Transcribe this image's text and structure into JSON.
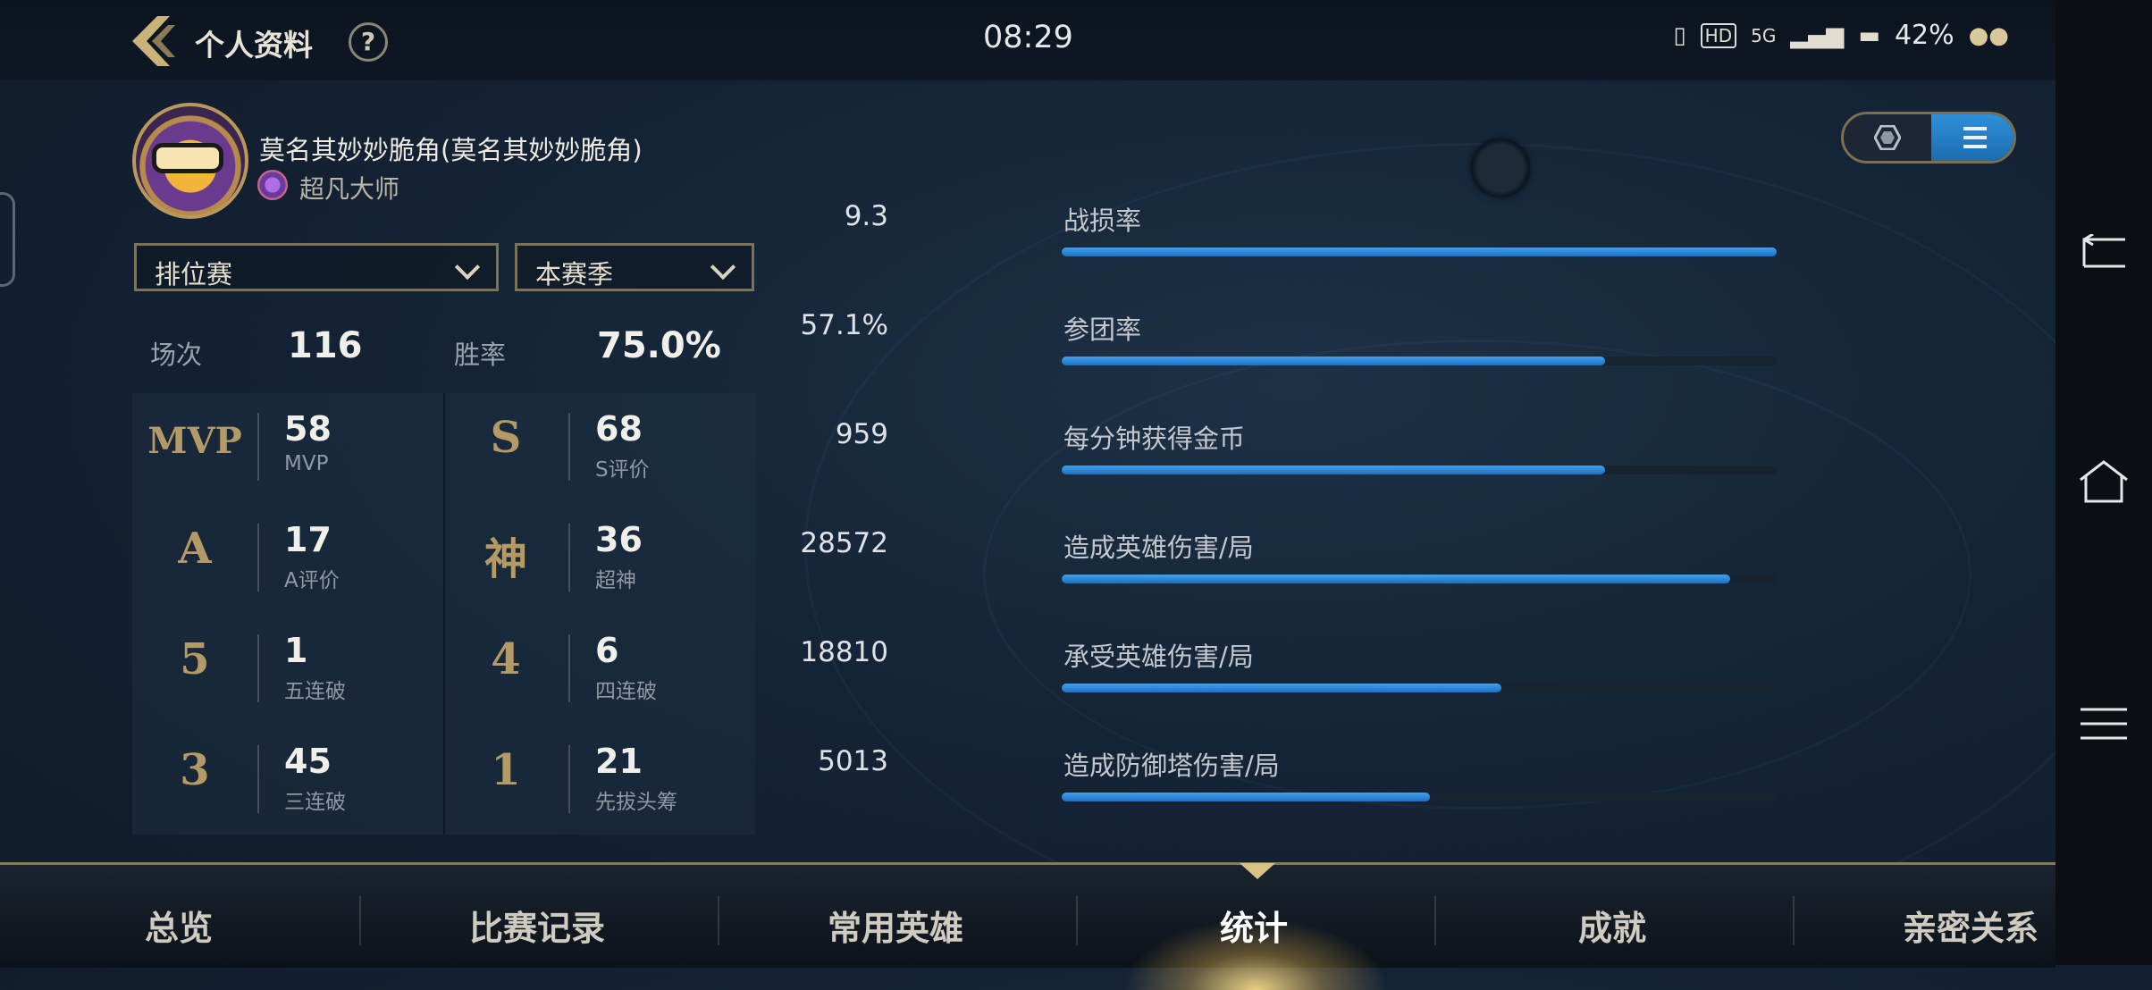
{
  "header": {
    "title": "个人资料",
    "help_label": "?",
    "time": "08:29"
  },
  "status_bar": {
    "battery": "42%",
    "network": "5G",
    "hd": "HD"
  },
  "profile": {
    "name": "莫名其妙妙脆角(莫名其妙妙脆角)",
    "rank": "超凡大师"
  },
  "filters": {
    "mode": "排位赛",
    "season": "本赛季"
  },
  "summary": {
    "games_label": "场次",
    "games": "116",
    "winrate_label": "胜率",
    "winrate": "75.0%"
  },
  "stats": [
    {
      "symbol": "MVP",
      "value": "58",
      "label": "MVP"
    },
    {
      "symbol": "S",
      "value": "68",
      "label": "S评价"
    },
    {
      "symbol": "A",
      "value": "17",
      "label": "A评价"
    },
    {
      "symbol": "神",
      "value": "36",
      "label": "超神"
    },
    {
      "symbol": "5",
      "value": "1",
      "label": "五连破"
    },
    {
      "symbol": "4",
      "value": "6",
      "label": "四连破"
    },
    {
      "symbol": "3",
      "value": "45",
      "label": "三连破"
    },
    {
      "symbol": "1",
      "value": "21",
      "label": "先拔头筹"
    }
  ],
  "metrics": [
    {
      "label": "战损率",
      "value": "9.3",
      "fill": 1.0
    },
    {
      "label": "参团率",
      "value": "57.1%",
      "fill": 0.76
    },
    {
      "label": "每分钟获得金币",
      "value": "959",
      "fill": 0.76
    },
    {
      "label": "造成英雄伤害/局",
      "value": "28572",
      "fill": 0.935
    },
    {
      "label": "承受英雄伤害/局",
      "value": "18810",
      "fill": 0.615
    },
    {
      "label": "造成防御塔伤害/局",
      "value": "5013",
      "fill": 0.515
    }
  ],
  "view_toggle": {
    "options": [
      "hexagon-view",
      "list-view"
    ],
    "selected": "list-view"
  },
  "tabs": [
    "总览",
    "比赛记录",
    "常用英雄",
    "统计",
    "成就",
    "亲密关系"
  ],
  "active_tab": "统计",
  "colors": {
    "accent": "#1e7fd0",
    "gold": "#b39a66",
    "background": "#142336"
  }
}
